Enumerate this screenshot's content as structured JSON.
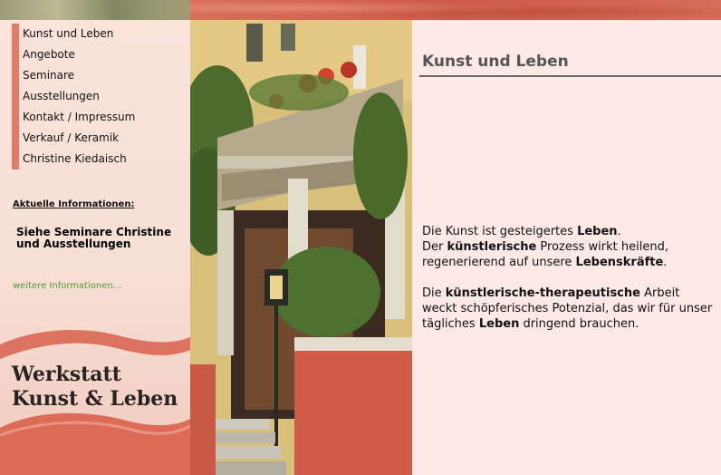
{
  "nav": {
    "items": [
      {
        "label": "Kunst und Leben"
      },
      {
        "label": "Angebote"
      },
      {
        "label": "Seminare"
      },
      {
        "label": "Ausstellungen"
      },
      {
        "label": "Kontakt / Impressum"
      },
      {
        "label": "Verkauf / Keramik"
      },
      {
        "label": "Christine Kiedaisch"
      }
    ]
  },
  "sidebar": {
    "info_heading": "Aktuelle Informationen:",
    "info_link": "Siehe Seminare Christine und Ausstellungen",
    "more_link": "weitere Informationen...",
    "logo_line1": "Werkstatt",
    "logo_line2": "Kunst & Leben"
  },
  "main": {
    "title": "Kunst und Leben",
    "p1": {
      "a": "Die Kunst ist gesteigertes ",
      "b": "Leben",
      "c": ".",
      "d": "Der ",
      "e": "künstlerische",
      "f": " Prozess wirkt heilend, regenerierend auf unsere ",
      "g": "Lebenskräfte",
      "h": "."
    },
    "p2": {
      "a": "Die ",
      "b": "künstlerische-therapeutische",
      "c": " Arbeit weckt schöpferisches Potenzial, das wir für unser tägliches ",
      "d": "Leben",
      "e": " dringend brauchen."
    }
  },
  "colors": {
    "nav_bar": "#e37b66",
    "page_bg": "#fde9e6",
    "link_green": "#4f9a36",
    "wave_red": "#d9604c"
  },
  "photo": {
    "icon": "house-balcony-photo"
  }
}
